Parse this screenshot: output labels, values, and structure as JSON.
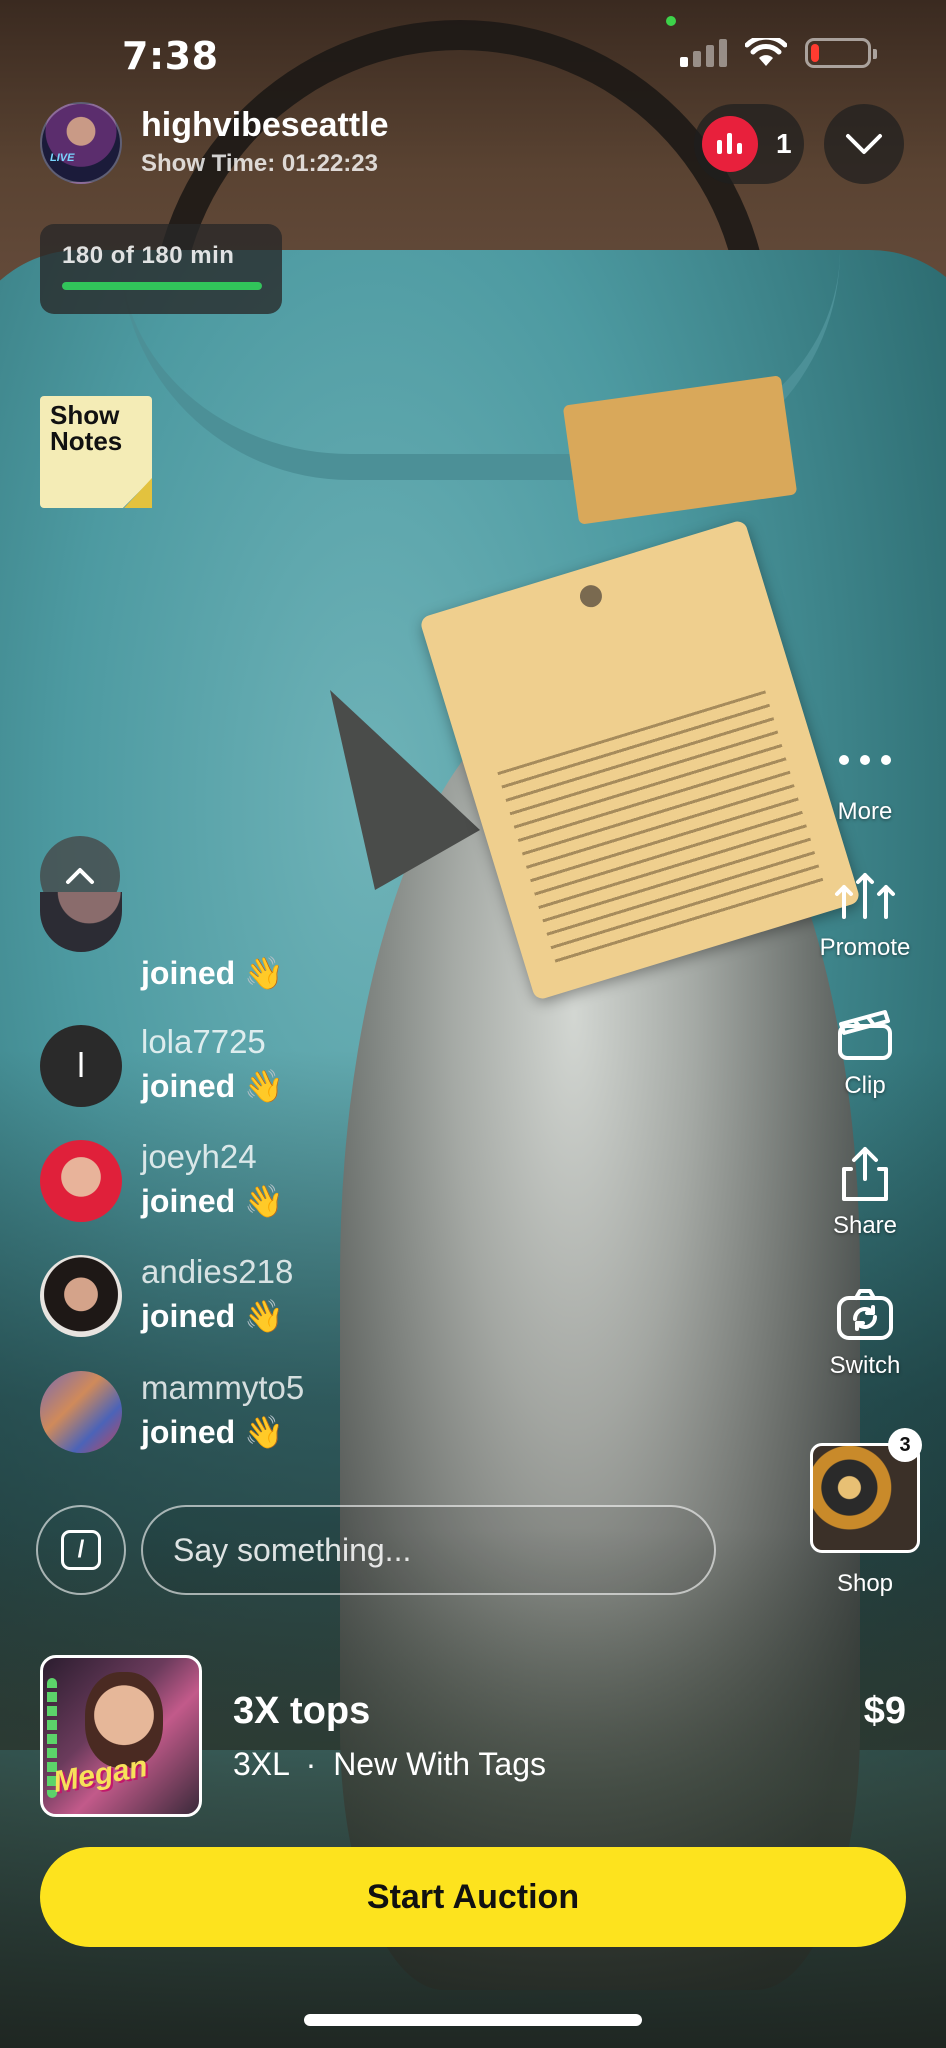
{
  "status_bar": {
    "time": "7:38",
    "signal_bars_on": 1,
    "battery_level": 0.15,
    "battery_color": "#ff3b30"
  },
  "host": {
    "username": "highvibeseattle",
    "show_time": "Show Time: 01:22:23",
    "avatar_badge": "LIVE"
  },
  "viewers": {
    "count": "1",
    "icon": "bar-chart-icon",
    "accent": "#e8203c"
  },
  "timer": {
    "text": "180 of 180 min",
    "progress": 1.0,
    "color": "#31c45a"
  },
  "show_notes": {
    "label": "Show Notes"
  },
  "side_actions": [
    {
      "label": "More",
      "icon": "more-dots-icon"
    },
    {
      "label": "Promote",
      "icon": "promote-arrows-icon"
    },
    {
      "label": "Clip",
      "icon": "clapperboard-icon"
    },
    {
      "label": "Share",
      "icon": "share-icon"
    },
    {
      "label": "Switch",
      "icon": "switch-camera-icon"
    }
  ],
  "shop": {
    "label": "Shop",
    "badge": "3"
  },
  "chat": {
    "messages": [
      {
        "user": "",
        "text": "joined 👋"
      },
      {
        "user": "lola7725",
        "text": "joined 👋",
        "avatar_letter": "l"
      },
      {
        "user": "joeyh24",
        "text": "joined 👋"
      },
      {
        "user": "andies218",
        "text": "joined 👋"
      },
      {
        "user": "mammyto5",
        "text": "joined 👋"
      }
    ],
    "input_placeholder": "Say something..."
  },
  "product": {
    "title": "3X tops",
    "size": "3XL",
    "separator": "·",
    "condition": "New With Tags",
    "price": "$9",
    "thumb_text": "Megan"
  },
  "primary_action": {
    "label": "Start Auction",
    "color": "#fde31e"
  }
}
